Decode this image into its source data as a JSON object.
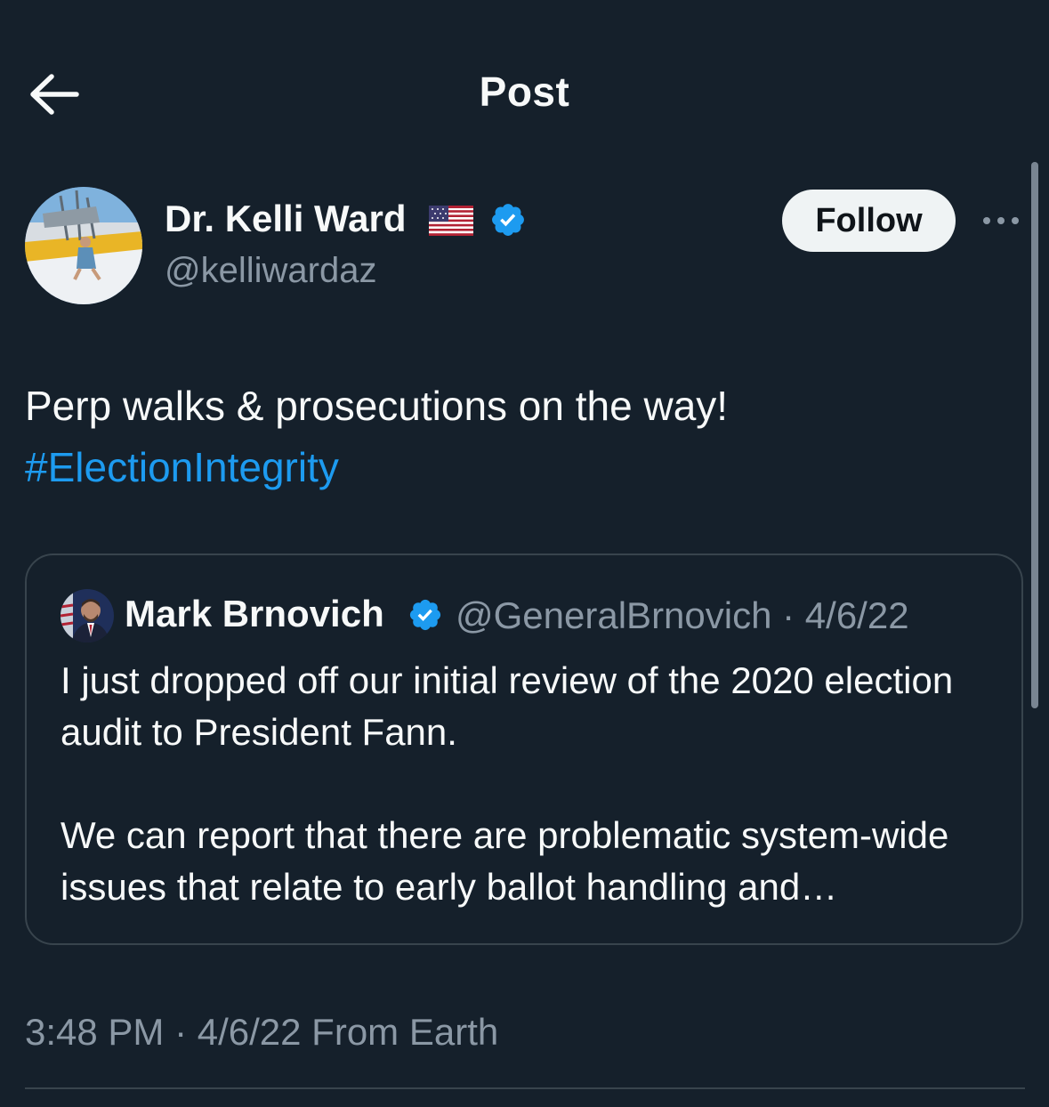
{
  "header": {
    "title": "Post",
    "back_icon": "arrow-left-icon"
  },
  "post": {
    "author": {
      "name": "Dr. Kelli Ward",
      "flag_emoji": "🇺🇸",
      "verified": true,
      "handle": "@kelliwardaz"
    },
    "follow_label": "Follow",
    "more_icon": "more-horizontal-icon",
    "text": "Perp walks & prosecutions on the way!",
    "hashtag": "#ElectionIntegrity",
    "timestamp": "3:48 PM · 4/6/22 From Earth"
  },
  "quote": {
    "author_name": "Mark Brnovich",
    "verified": true,
    "handle_and_date": "@GeneralBrnovich · 4/6/22",
    "body": "I just dropped off our initial review of the 2020 election audit to President Fann.\n\nWe can report that there are problematic system-wide issues that relate to early ballot handling and…"
  },
  "colors": {
    "background": "#15202b",
    "text_primary": "#f7f9f9",
    "text_secondary": "#8b98a5",
    "accent": "#1d9bf0",
    "border": "#38444d",
    "follow_bg": "#eff3f4"
  }
}
